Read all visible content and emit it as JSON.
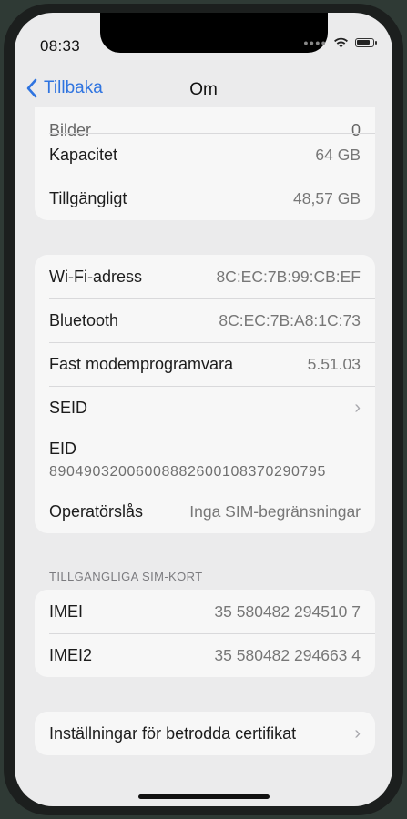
{
  "status": {
    "time": "08:33"
  },
  "nav": {
    "back_label": "Tillbaka",
    "title": "Om"
  },
  "storage": {
    "cut_label": "Bilder",
    "cut_value": "0",
    "rows": [
      {
        "label": "Kapacitet",
        "value": "64 GB"
      },
      {
        "label": "Tillgängligt",
        "value": "48,57 GB"
      }
    ]
  },
  "network": {
    "rows": [
      {
        "label": "Wi-Fi-adress",
        "value": "8C:EC:7B:99:CB:EF"
      },
      {
        "label": "Bluetooth",
        "value": "8C:EC:7B:A8:1C:73"
      },
      {
        "label": "Fast modemprogramvara",
        "value": "5.51.03"
      },
      {
        "label": "SEID",
        "value": ""
      },
      {
        "label": "EID",
        "value": "89049032006008882600108370290795"
      },
      {
        "label": "Operatörslås",
        "value": "Inga SIM-begränsningar"
      }
    ]
  },
  "sim": {
    "header": "TILLGÄNGLIGA SIM-KORT",
    "rows": [
      {
        "label": "IMEI",
        "value": "35 580482 294510 7"
      },
      {
        "label": "IMEI2",
        "value": "35 580482 294663 4"
      }
    ]
  },
  "certs": {
    "label": "Inställningar för betrodda certifikat"
  },
  "icons": {
    "back": "chevron-left-icon",
    "disclosure": "chevron-right-icon",
    "wifi": "wifi-icon",
    "battery": "battery-icon"
  },
  "colors": {
    "accent": "#2f74e0",
    "background": "#ebebec",
    "cell": "#f7f7f7"
  }
}
